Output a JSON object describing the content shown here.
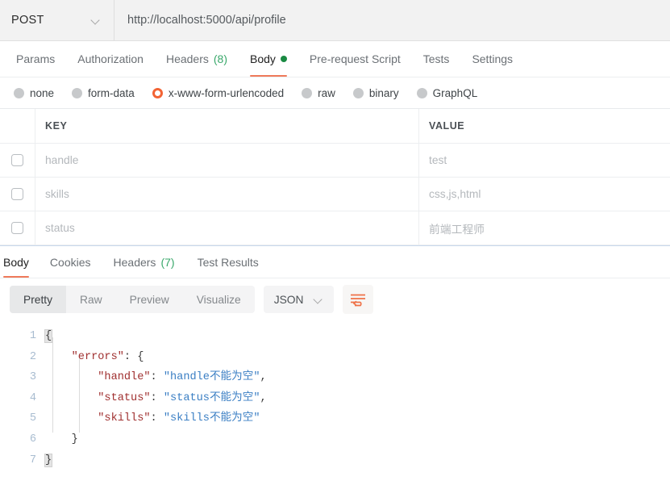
{
  "request_bar": {
    "method": "POST",
    "method_chevron_icon": "chevron-down-icon",
    "url": "http://localhost:5000/api/profile"
  },
  "request_tabs": [
    {
      "label": "Params",
      "active": false
    },
    {
      "label": "Authorization",
      "active": false
    },
    {
      "label": "Headers",
      "count": "(8)",
      "active": false
    },
    {
      "label": "Body",
      "active": true,
      "indicator": "green-dot"
    },
    {
      "label": "Pre-request Script",
      "active": false
    },
    {
      "label": "Tests",
      "active": false
    },
    {
      "label": "Settings",
      "active": false
    }
  ],
  "body_types": [
    {
      "label": "none",
      "selected": false
    },
    {
      "label": "form-data",
      "selected": false
    },
    {
      "label": "x-www-form-urlencoded",
      "selected": true
    },
    {
      "label": "raw",
      "selected": false
    },
    {
      "label": "binary",
      "selected": false
    },
    {
      "label": "GraphQL",
      "selected": false
    }
  ],
  "kv_table": {
    "headers": {
      "key": "KEY",
      "value": "VALUE"
    },
    "rows": [
      {
        "checked": false,
        "key": "handle",
        "value": "test"
      },
      {
        "checked": false,
        "key": "skills",
        "value": "css,js,html"
      },
      {
        "checked": false,
        "key": "status",
        "value": "前端工程师"
      }
    ]
  },
  "response_tabs": [
    {
      "label": "Body",
      "active": true
    },
    {
      "label": "Cookies",
      "active": false
    },
    {
      "label": "Headers",
      "count": "(7)",
      "active": false
    },
    {
      "label": "Test Results",
      "active": false
    }
  ],
  "view_controls": {
    "segments": [
      {
        "label": "Pretty",
        "active": true
      },
      {
        "label": "Raw",
        "active": false
      },
      {
        "label": "Preview",
        "active": false
      },
      {
        "label": "Visualize",
        "active": false
      }
    ],
    "format": "JSON",
    "format_chevron_icon": "chevron-down-icon",
    "wrap_icon": "word-wrap-icon"
  },
  "code_viewer": {
    "line_numbers": [
      "1",
      "2",
      "3",
      "4",
      "5",
      "6",
      "7"
    ],
    "lines": [
      {
        "n": 1,
        "indent": 0,
        "tokens": [
          {
            "t": "{",
            "c": "brace-hl"
          }
        ]
      },
      {
        "n": 2,
        "indent": 1,
        "tokens": [
          {
            "t": "\"errors\"",
            "c": "k"
          },
          {
            "t": ": ",
            "c": "p"
          },
          {
            "t": "{",
            "c": "p"
          }
        ]
      },
      {
        "n": 3,
        "indent": 2,
        "tokens": [
          {
            "t": "\"handle\"",
            "c": "k"
          },
          {
            "t": ": ",
            "c": "p"
          },
          {
            "t": "\"handle不能为空\"",
            "c": "s"
          },
          {
            "t": ",",
            "c": "p"
          }
        ]
      },
      {
        "n": 4,
        "indent": 2,
        "tokens": [
          {
            "t": "\"status\"",
            "c": "k"
          },
          {
            "t": ": ",
            "c": "p"
          },
          {
            "t": "\"status不能为空\"",
            "c": "s"
          },
          {
            "t": ",",
            "c": "p"
          }
        ]
      },
      {
        "n": 5,
        "indent": 2,
        "tokens": [
          {
            "t": "\"skills\"",
            "c": "k"
          },
          {
            "t": ": ",
            "c": "p"
          },
          {
            "t": "\"skills不能为空\"",
            "c": "s"
          }
        ]
      },
      {
        "n": 6,
        "indent": 1,
        "tokens": [
          {
            "t": "}",
            "c": "p"
          }
        ]
      },
      {
        "n": 7,
        "indent": 0,
        "tokens": [
          {
            "t": "}",
            "c": "brace-hl"
          }
        ]
      }
    ]
  },
  "colors": {
    "accent_orange": "#f26334",
    "tab_underline": "#ef7a5a",
    "green_dot": "#1a8a43",
    "green_count": "#3aa86b",
    "json_key": "#a03030",
    "json_string": "#3b7fc4",
    "bar_bg": "#f2f2f2"
  }
}
